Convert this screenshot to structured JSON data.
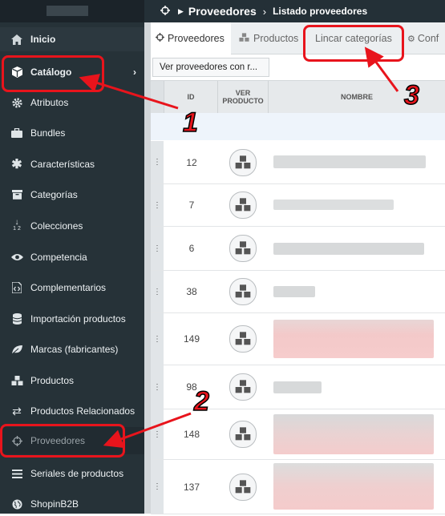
{
  "sidebar": {
    "items": [
      {
        "label": "Inicio",
        "icon": "home-icon"
      },
      {
        "label": "Catálogo",
        "icon": "cube-icon"
      },
      {
        "label": "Atributos",
        "icon": "cog-icon"
      },
      {
        "label": "Bundles",
        "icon": "briefcase-icon"
      },
      {
        "label": "Características",
        "icon": "asterisk-icon"
      },
      {
        "label": "Categorías",
        "icon": "archive-icon"
      },
      {
        "label": "Colecciones",
        "icon": "sort-numeric-icon"
      },
      {
        "label": "Competencia",
        "icon": "eye-icon"
      },
      {
        "label": "Complementarios",
        "icon": "code-file-icon"
      },
      {
        "label": "Importación productos",
        "icon": "database-icon"
      },
      {
        "label": "Marcas (fabricantes)",
        "icon": "leaf-icon"
      },
      {
        "label": "Productos",
        "icon": "cubes-icon"
      },
      {
        "label": "Productos Relacionados",
        "icon": "exchange-icon"
      },
      {
        "label": "Proveedores",
        "icon": "crosshairs-icon"
      },
      {
        "label": "Seriales de productos",
        "icon": "list-icon"
      },
      {
        "label": "ShopinB2B",
        "icon": "globe-icon"
      }
    ]
  },
  "breadcrumb": {
    "section": "Proveedores",
    "page": "Listado proveedores"
  },
  "tabs": [
    {
      "label": "Proveedores",
      "icon": "crosshairs-icon"
    },
    {
      "label": "Productos",
      "icon": "cubes-icon"
    },
    {
      "label": "Lincar categorías",
      "icon": ""
    },
    {
      "label": "Conf",
      "icon": "cogs-icon"
    }
  ],
  "toolbar": {
    "ver_proveedores": "Ver proveedores con r..."
  },
  "table": {
    "headers": {
      "id": "ID",
      "ver_producto_1": "VER",
      "ver_producto_2": "PRODUCTO",
      "nombre": "NOMBRE"
    },
    "rows": [
      {
        "id": "12"
      },
      {
        "id": "7"
      },
      {
        "id": "6"
      },
      {
        "id": "38"
      },
      {
        "id": "149"
      },
      {
        "id": "98"
      },
      {
        "id": "148"
      },
      {
        "id": "137"
      }
    ]
  },
  "annotations": {
    "n1": "1",
    "n2": "2",
    "n3": "3"
  },
  "colors": {
    "sidebar_bg": "#263238",
    "highlight": "#e8141c",
    "filter_row": "#eef4fb"
  }
}
